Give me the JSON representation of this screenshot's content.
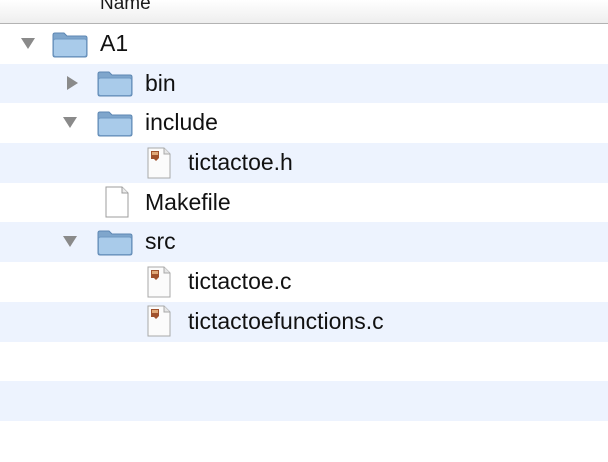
{
  "header": {
    "name_column": "Name"
  },
  "rows": [
    {
      "label": "A1",
      "kind": "folder",
      "disclosure": "expanded"
    },
    {
      "label": "bin",
      "kind": "folder",
      "disclosure": "collapsed"
    },
    {
      "label": "include",
      "kind": "folder",
      "disclosure": "expanded"
    },
    {
      "label": "tictactoe.h",
      "kind": "source-file"
    },
    {
      "label": "Makefile",
      "kind": "plain-file"
    },
    {
      "label": "src",
      "kind": "folder",
      "disclosure": "expanded"
    },
    {
      "label": "tictactoe.c",
      "kind": "source-file"
    },
    {
      "label": "tictactoefunctions.c",
      "kind": "source-file"
    }
  ],
  "colors": {
    "stripe": "#edf3fe",
    "folder": "#9fc3e6",
    "disclosure": "#8a8a8a"
  }
}
